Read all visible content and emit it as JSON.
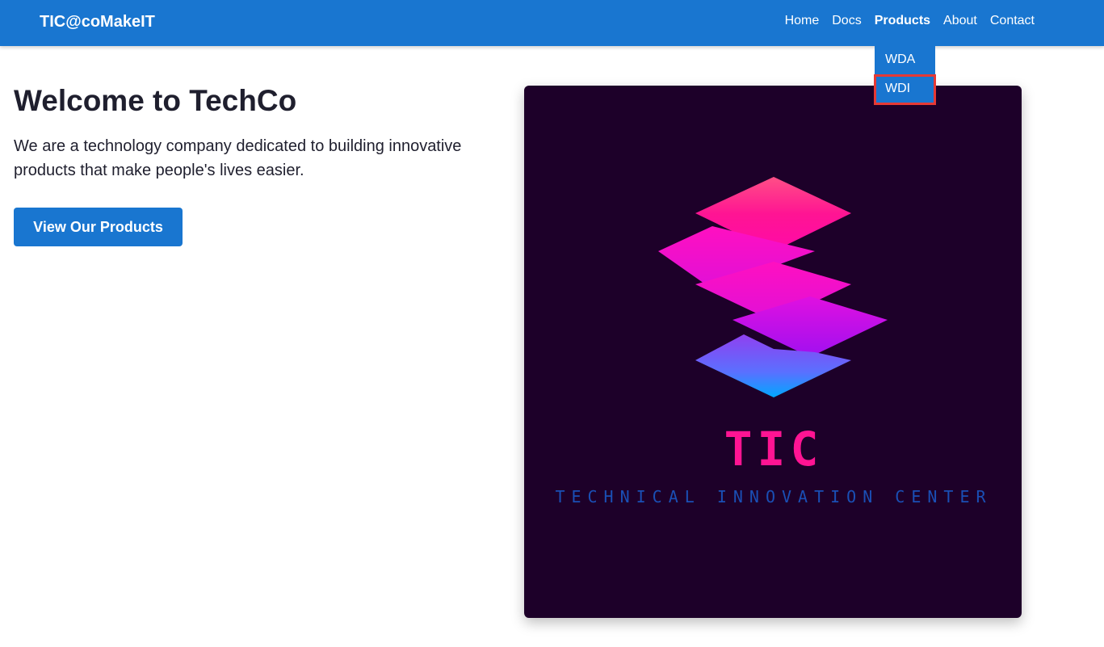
{
  "navbar": {
    "brand": "TIC@coMakeIT",
    "links": [
      "Home",
      "Docs",
      "Products",
      "About",
      "Contact"
    ],
    "active": "Products",
    "background": "#1976d0"
  },
  "products_dropdown": {
    "items": [
      "WDA",
      "WDI"
    ],
    "highlighted": "WDI"
  },
  "hero": {
    "title": "Welcome to TechCo",
    "text": "We are a technology company dedicated to building innovative products that make people's lives easier.",
    "button_label": "View Our Products"
  },
  "logo_image": {
    "wordmark": "TIC",
    "tagline": "TECHNICAL INNOVATION CENTER",
    "background": "#1d0029",
    "wordmark_color": "#ff1493",
    "tagline_color": "#1a4fb5"
  }
}
